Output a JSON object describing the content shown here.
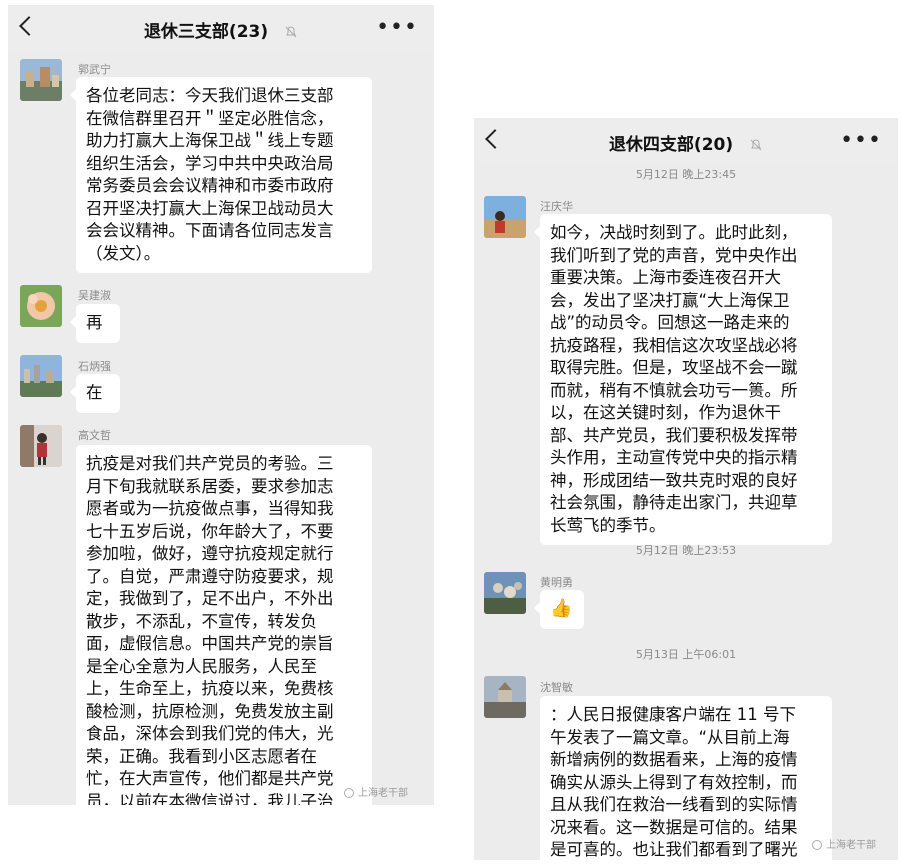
{
  "left_chat": {
    "title": "退休三支部(23)",
    "messages": [
      {
        "sender": "郭武宁",
        "text": "各位老同志：今天我们退休三支部\n在微信群里召开＂坚定必胜信念，\n助力打赢大上海保卫战＂线上专题\n组织生活会，学习中共中央政治局\n常务委员会会议精神和市委市政府\n召开坚决打赢大上海保卫战动员大\n会会议精神。下面请各位同志发言\n（发文）。"
      },
      {
        "sender": "吴建淑",
        "text": "再"
      },
      {
        "sender": "石炳强",
        "text": "在"
      },
      {
        "sender": "高文哲",
        "text": "抗疫是对我们共产党员的考验。三\n月下旬我就联系居委，要求参加志\n愿者或为一抗疫做点事，当得知我\n七十五岁后说，你年龄大了，不要\n参加啦，做好，遵守抗疫规定就行\n了。自觉，严肃遵守防疫要求，规\n定，我做到了，足不出户，不外出\n散步，不添乱，不宣传，转发负\n面，虚假信息。中国共产党的崇旨\n是全心全意为人民服务，人民至\n上，生命至上，抗疫以来，免费核\n酸检测，抗原检测，免费发放主副\n食品，深体会到我们党的伟大，光\n荣，正确。我看到小区志愿者在\n忙，在大声宣传，他们都是共产党\n员，以前在本微信说过，我儿子治"
      }
    ]
  },
  "right_chat": {
    "title": "退休四支部(20)",
    "top_timestamp": "5月12日 晚上23:45",
    "messages": [
      {
        "sender": "汪庆华",
        "text": "如今，决战时刻到了。此时此刻，\n我们听到了党的声音，党中央作出\n重要决策。上海市委连夜召开大\n会，发出了坚决打赢“大上海保卫\n战”的动员令。回想这一路走来的\n抗疫路程，我相信这次攻坚战必将\n取得完胜。但是，攻坚战不会一蹴\n而就，稍有不慎就会功亏一篑。所\n以，在这关键时刻，作为退休干\n部、共产党员，我们要积极发挥带\n头作用，主动宣传党中央的指示精\n神，形成团结一致共克时艰的良好\n社会氛围，静待走出家门，共迎草\n长莺飞的季节。"
      },
      {
        "timestamp": "5月12日 晚上23:53"
      },
      {
        "sender": "黄明勇",
        "emoji": "👍"
      },
      {
        "timestamp": "5月13日 上午06:01"
      },
      {
        "sender": "沈智敏",
        "text": "：人民日报健康客户端在 11 号下\n午发表了一篇文章。“从目前上海\n新增病例的数据看来，上海的疫情\n确实从源头上得到了有效控制，而\n且从我们在救治一线看到的实际情\n况来看。这一数据是可信的。结果\n是可喜的。也让我们都看到了曙光"
      }
    ]
  },
  "watermark": "上海老干部",
  "colors": {
    "chat_bg": "#ececec",
    "bubble": "#ffffff",
    "meta_text": "#8a8a8a"
  }
}
